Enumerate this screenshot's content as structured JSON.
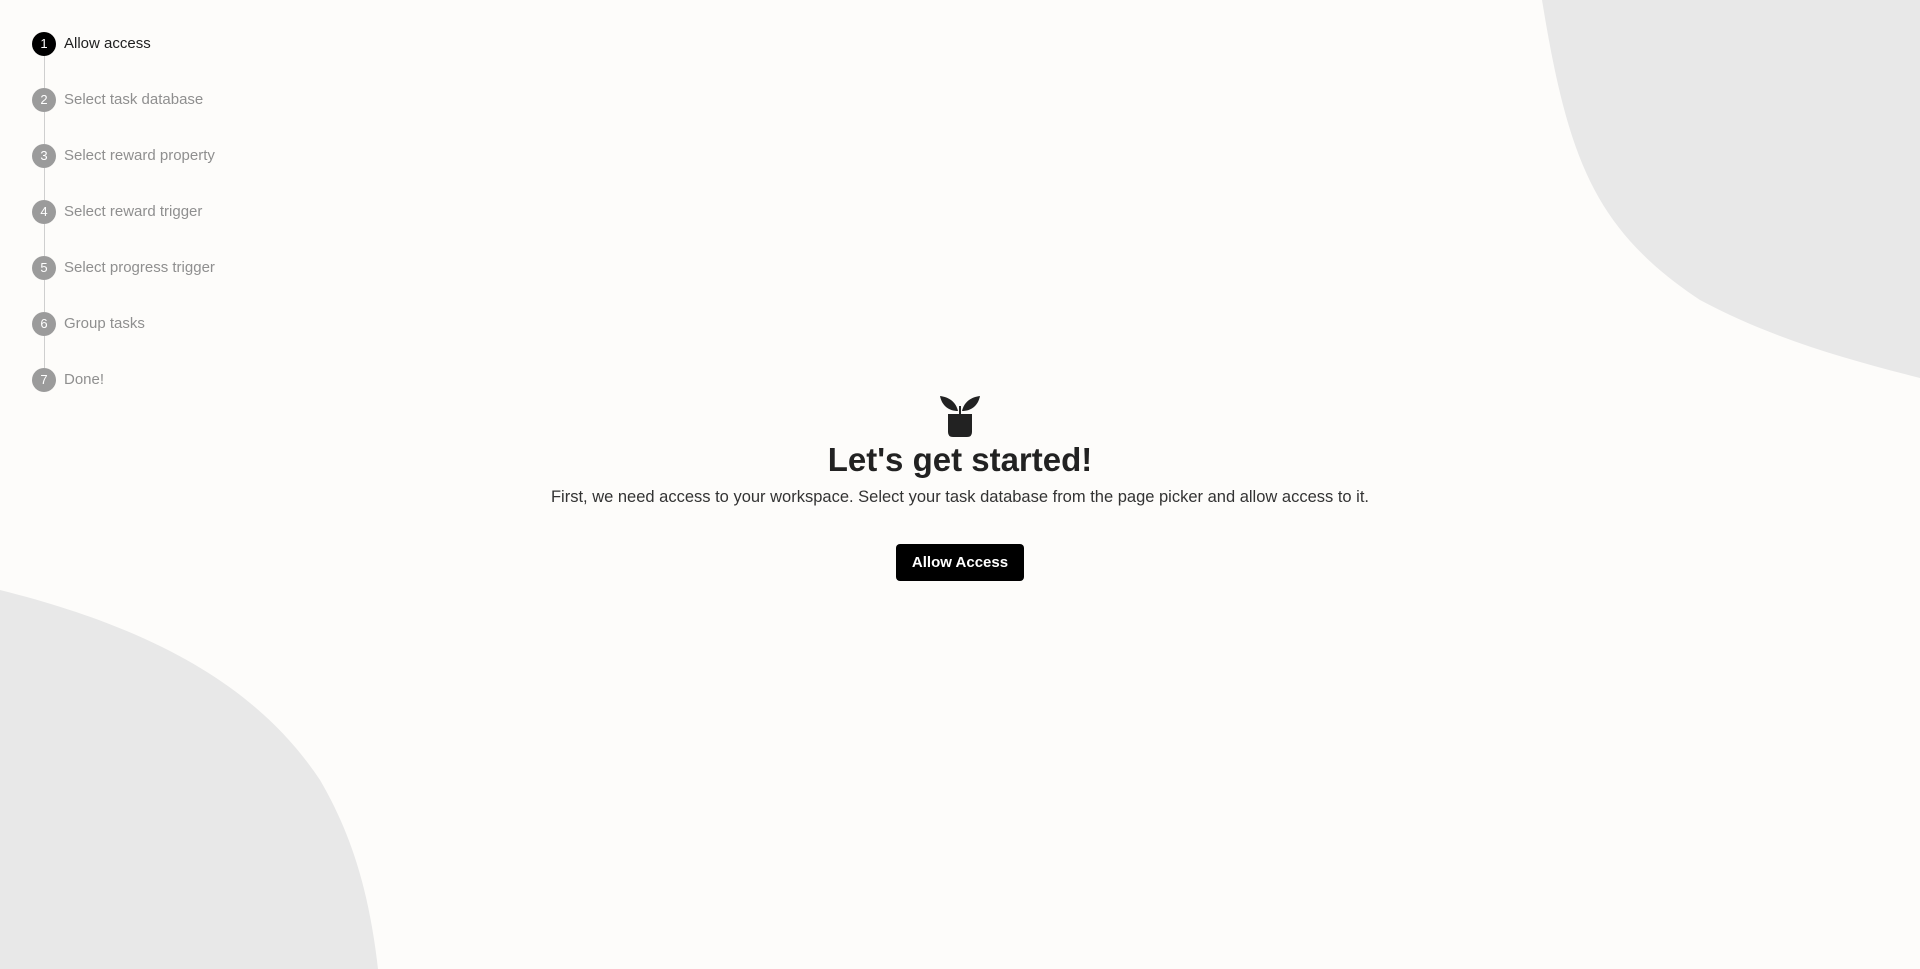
{
  "stepper": {
    "steps": [
      {
        "number": "1",
        "label": "Allow access",
        "active": true
      },
      {
        "number": "2",
        "label": "Select task database",
        "active": false
      },
      {
        "number": "3",
        "label": "Select reward property",
        "active": false
      },
      {
        "number": "4",
        "label": "Select reward trigger",
        "active": false
      },
      {
        "number": "5",
        "label": "Select progress trigger",
        "active": false
      },
      {
        "number": "6",
        "label": "Group tasks",
        "active": false
      },
      {
        "number": "7",
        "label": "Done!",
        "active": false
      }
    ]
  },
  "main": {
    "icon": "plant-icon",
    "title": "Let's get started!",
    "subtitle": "First, we need access to your workspace. Select your task database from the page picker and allow access to it.",
    "button_label": "Allow Access"
  },
  "colors": {
    "background": "#fdfcfa",
    "blob": "#e8e8e8",
    "accent": "#000000",
    "inactive_step": "#9b9b9b"
  }
}
